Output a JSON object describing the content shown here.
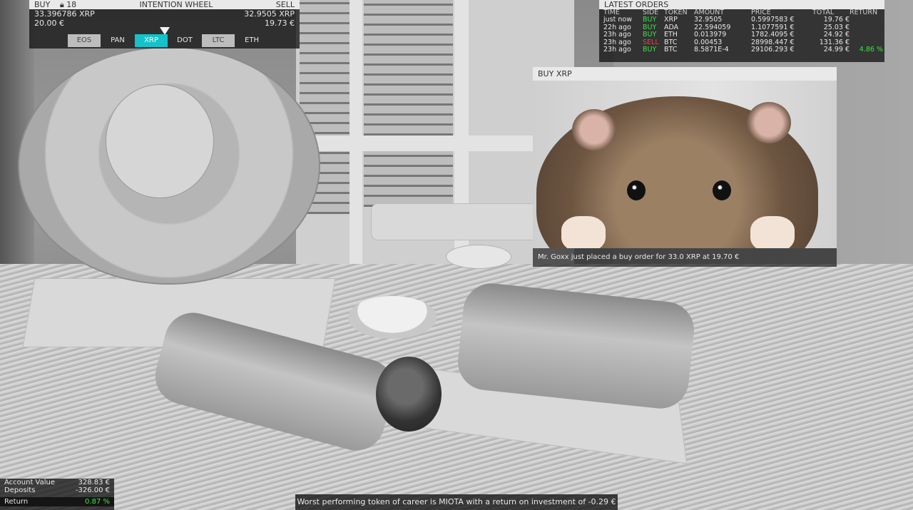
{
  "intention_wheel": {
    "buy_label": "BUY",
    "lock_icon": "lock-icon",
    "lock_count": "18",
    "title": "INTENTION WHEEL",
    "sell_label": "SELL",
    "left_amount": "33.396786 XRP",
    "right_amount": "32.9505 XRP",
    "left_value": "20.00 €",
    "right_value": "19.73 €",
    "tokens": [
      "EOS",
      "PAN",
      "XRP",
      "DOT",
      "LTC",
      "ETH"
    ],
    "selected_token": "XRP",
    "accent_color": "#16c1c9"
  },
  "latest_orders": {
    "title": "LATEST ORDERS",
    "columns": [
      "TIME",
      "SIDE",
      "TOKEN",
      "AMOUNT",
      "PRICE",
      "TOTAL",
      "RETURN"
    ],
    "rows": [
      {
        "time": "just now",
        "side": "BUY",
        "token": "XRP",
        "amount": "32.9505",
        "price": "0.5997583 €",
        "total": "19.76 €",
        "return": ""
      },
      {
        "time": "22h ago",
        "side": "BUY",
        "token": "ADA",
        "amount": "22.594059",
        "price": "1.1077591 €",
        "total": "25.03 €",
        "return": ""
      },
      {
        "time": "23h ago",
        "side": "BUY",
        "token": "ETH",
        "amount": "0.013979",
        "price": "1782.4095 €",
        "total": "24.92 €",
        "return": ""
      },
      {
        "time": "23h ago",
        "side": "SELL",
        "token": "BTC",
        "amount": "0.00453",
        "price": "28998.447 €",
        "total": "131.36 €",
        "return": ""
      },
      {
        "time": "23h ago",
        "side": "BUY",
        "token": "BTC",
        "amount": "8.5871E-4",
        "price": "29106.293 €",
        "total": "24.99 €",
        "return": "4.86 %"
      }
    ]
  },
  "buy_popup": {
    "title": "BUY XRP",
    "caption": "Mr. Goxx just placed a buy order for 33.0 XRP at 19.70 €"
  },
  "account": {
    "account_value_label": "Account Value",
    "account_value": "328.83 €",
    "deposits_label": "Deposits",
    "deposits": "-326.00 €",
    "return_label": "Return",
    "return_value": "0.87 %"
  },
  "ticker": {
    "text": "Worst performing token of career is MIOTA with a return on investment of -0.29 €"
  }
}
